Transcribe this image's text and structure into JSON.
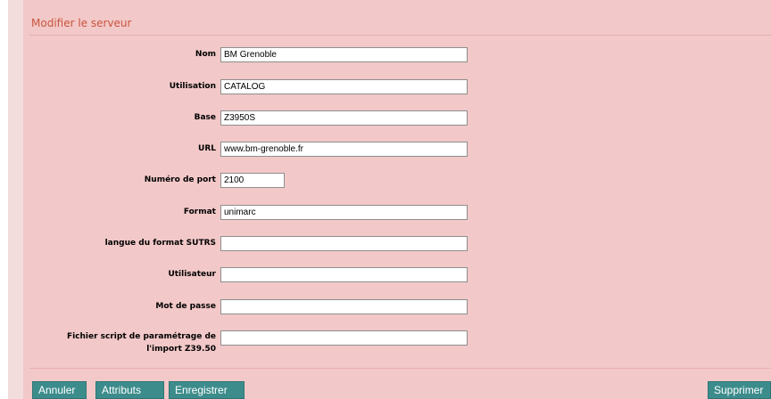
{
  "panel": {
    "title": "Modifier le serveur"
  },
  "form": {
    "fields": [
      {
        "label": "Nom",
        "value": "BM Grenoble"
      },
      {
        "label": "Utilisation",
        "value": "CATALOG"
      },
      {
        "label": "Base",
        "value": "Z3950S"
      },
      {
        "label": "URL",
        "value": "www.bm-grenoble.fr"
      },
      {
        "label": "Numéro de port",
        "value": "2100"
      },
      {
        "label": "Format",
        "value": "unimarc"
      },
      {
        "label": "langue du format SUTRS",
        "value": ""
      },
      {
        "label": "Utilisateur",
        "value": ""
      },
      {
        "label": "Mot de passe",
        "value": ""
      },
      {
        "label_line1": "Fichier script de paramétrage de",
        "label_line2": "l'import Z39.50",
        "value": ""
      }
    ]
  },
  "actions": {
    "cancel_label": "Annuler",
    "attributes_label": "Attributs",
    "save_label": "Enregistrer",
    "delete_label": "Supprimer"
  },
  "colors": {
    "panel_background": "#f2c8c8",
    "title_text": "#c9553e",
    "button_background": "#3d8c8c",
    "button_text": "#ffffff"
  }
}
